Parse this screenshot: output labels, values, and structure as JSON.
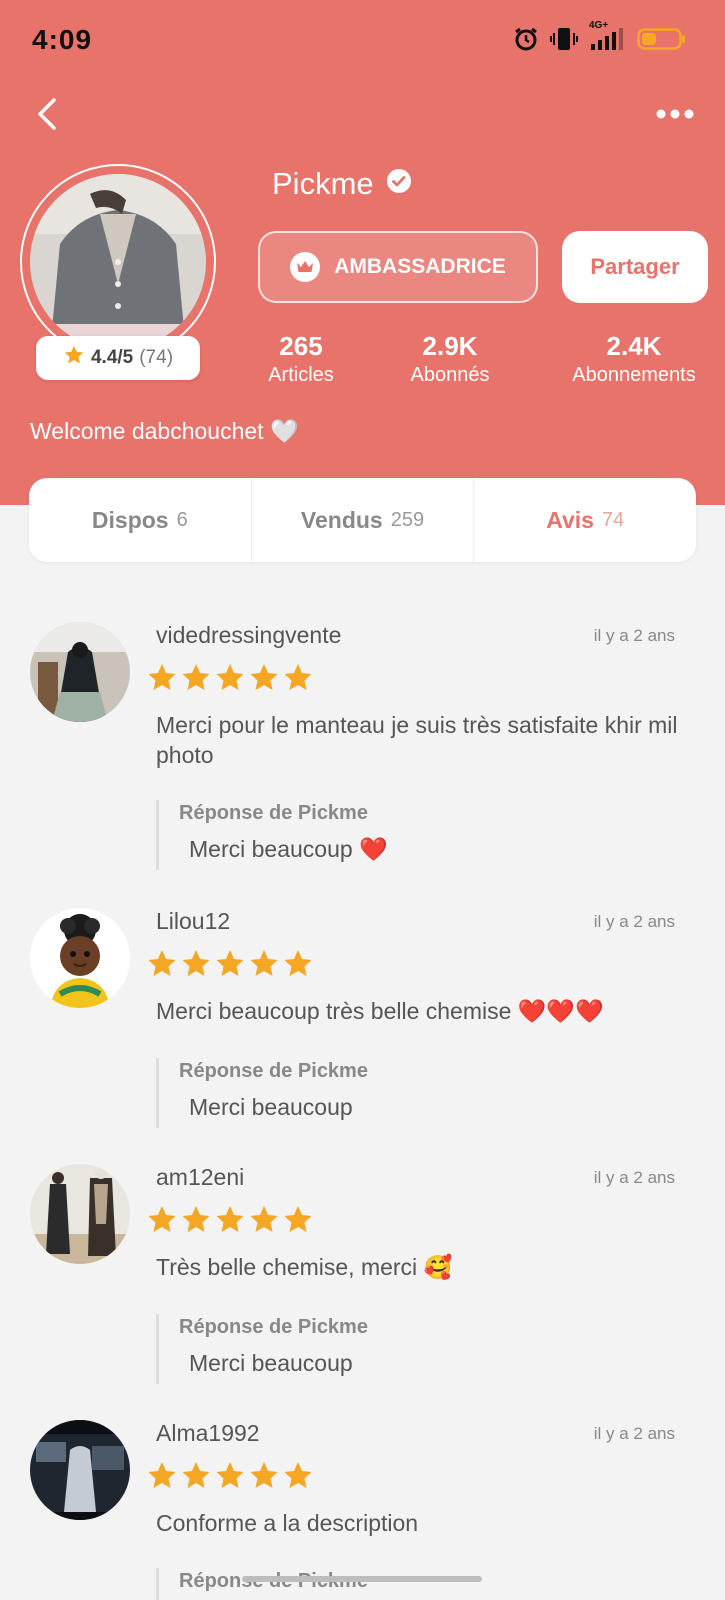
{
  "status_bar": {
    "time": "4:09",
    "network": "4G+"
  },
  "profile": {
    "name": "Pickme",
    "rating": "4.4/5",
    "rating_count": "(74)",
    "badge_label": "AMBASSADRICE",
    "share_label": "Partager",
    "bio": "Welcome dabchouchet 🤍",
    "stats": [
      {
        "value": "265",
        "label": "Articles"
      },
      {
        "value": "2.9K",
        "label": "Abonnés"
      },
      {
        "value": "2.4K",
        "label": "Abonnements"
      }
    ]
  },
  "tabs": [
    {
      "label": "Dispos",
      "count": "6"
    },
    {
      "label": "Vendus",
      "count": "259"
    },
    {
      "label": "Avis",
      "count": "74"
    }
  ],
  "reviews": [
    {
      "user": "videdressingvente",
      "time": "il y a 2 ans",
      "stars": 5,
      "text": "Merci pour le manteau je suis très satisfaite khir mil photo",
      "reply_title": "Réponse de Pickme",
      "reply_text": "Merci beaucoup ❤️"
    },
    {
      "user": "Lilou12",
      "time": "il y a 2 ans",
      "stars": 5,
      "text": "Merci beaucoup très belle chemise ❤️❤️❤️",
      "reply_title": "Réponse de Pickme",
      "reply_text": "Merci beaucoup"
    },
    {
      "user": "am12eni",
      "time": "il y a 2 ans",
      "stars": 5,
      "text": "Très belle chemise, merci 🥰",
      "reply_title": "Réponse de Pickme",
      "reply_text": "Merci beaucoup"
    },
    {
      "user": "Alma1992",
      "time": "il y a 2 ans",
      "stars": 5,
      "text": "Conforme a la description",
      "reply_title": "Réponse de Pickme",
      "reply_text": ""
    }
  ],
  "colors": {
    "brand": "#e8736b",
    "star": "#f5a623",
    "background": "#f3f3f3"
  }
}
